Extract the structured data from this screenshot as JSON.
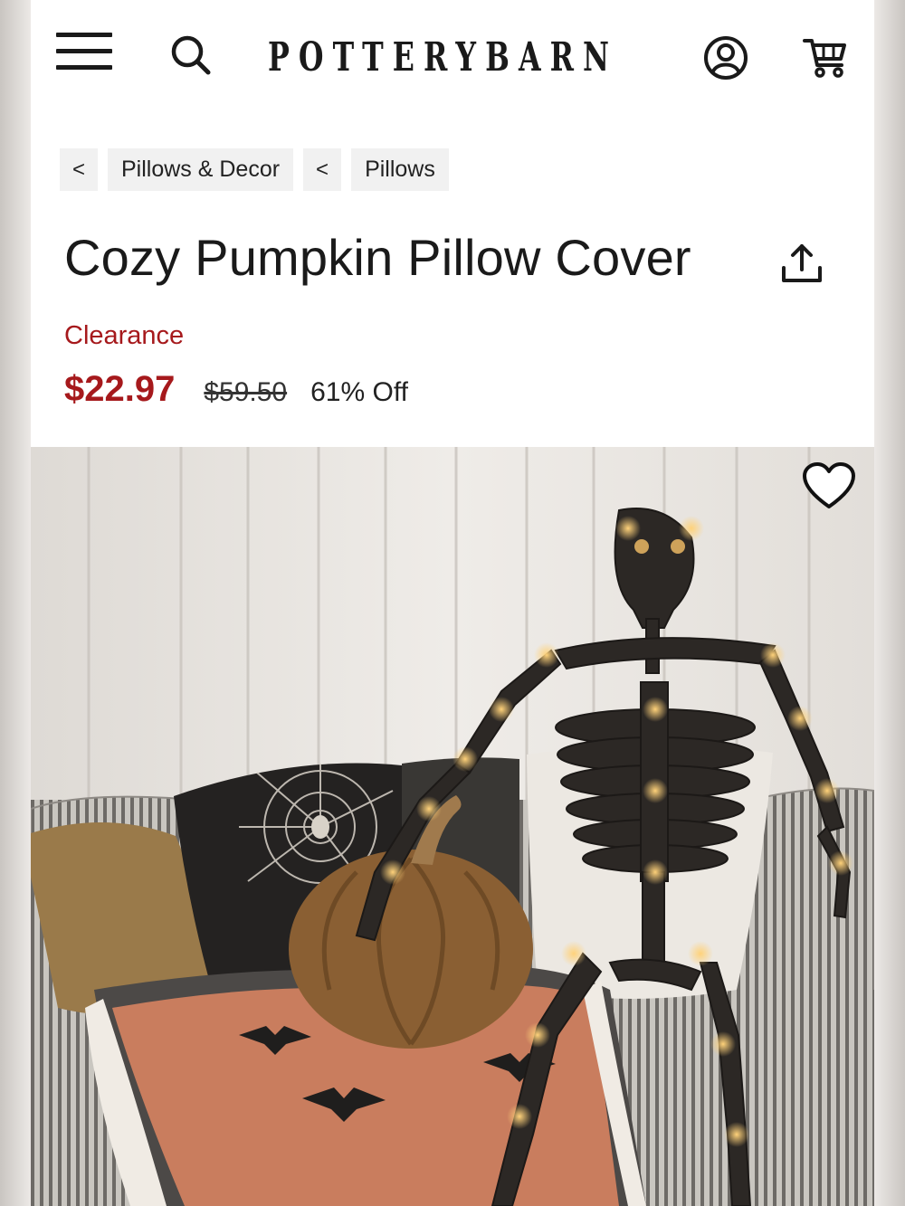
{
  "header": {
    "logo_text": "POTTERYBARN",
    "icons": [
      "menu-icon",
      "search-icon",
      "account-icon",
      "cart-icon"
    ]
  },
  "breadcrumb": {
    "items": [
      {
        "back": "<",
        "label": "Pillows & Decor"
      },
      {
        "back": "<",
        "label": "Pillows"
      }
    ]
  },
  "product": {
    "title": "Cozy Pumpkin Pillow Cover",
    "badge": "Clearance",
    "sale_price": "$22.97",
    "original_price": "$59.50",
    "discount": "61% Off"
  },
  "colors": {
    "accent_red": "#a6191c",
    "text": "#1a1a1a",
    "chip_bg": "#f1f1f1"
  },
  "image": {
    "icons": [
      "heart-icon",
      "share-icon"
    ]
  }
}
